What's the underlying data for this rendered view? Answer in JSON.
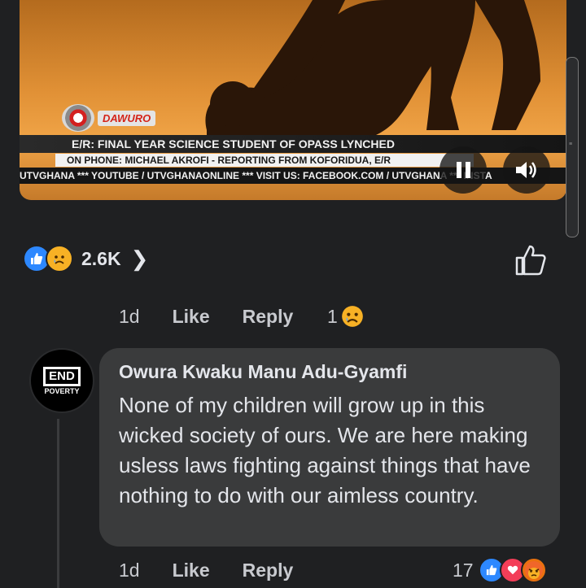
{
  "video": {
    "logo_text": "DAWURO",
    "ticker_headline": "E/R: FINAL YEAR SCIENCE STUDENT OF OPASS LYNCHED",
    "ticker_sub": "ON PHONE: MICHAEL AKROFI - REPORTING FROM KOFORIDUA, E/R",
    "ticker_crawl": "UTVGHANA *** YOUTUBE / UTVGHANAONLINE    ***  VISIT US: FACEBOOK.COM / UTVGHANA *** INSTA",
    "pause_icon": "pause-icon",
    "volume_icon": "volume-icon"
  },
  "post_reactions": {
    "count": "2.6K",
    "icons": [
      "like-icon",
      "sad-icon"
    ]
  },
  "reply_row_1": {
    "time": "1d",
    "like": "Like",
    "reply": "Reply",
    "reaction_count": "1",
    "reaction_icon": "sad-icon"
  },
  "comment": {
    "author": "Owura Kwaku Manu Adu-Gyamfi",
    "text": "None of my children will grow up in this wicked society of ours. We are here making usless laws fighting against things that have nothing to do with our aimless country.",
    "avatar_line1": "END",
    "avatar_line2": "POVERTY",
    "time": "1d",
    "like": "Like",
    "reply": "Reply",
    "reaction_count": "17",
    "reaction_icons": [
      "like-icon",
      "love-icon",
      "angry-icon"
    ]
  },
  "colors": {
    "background": "#1f2022",
    "bubble": "#3a3b3c",
    "like_blue": "#2d88ff",
    "love_red": "#f33e58",
    "sad_yellow": "#f7b125"
  }
}
